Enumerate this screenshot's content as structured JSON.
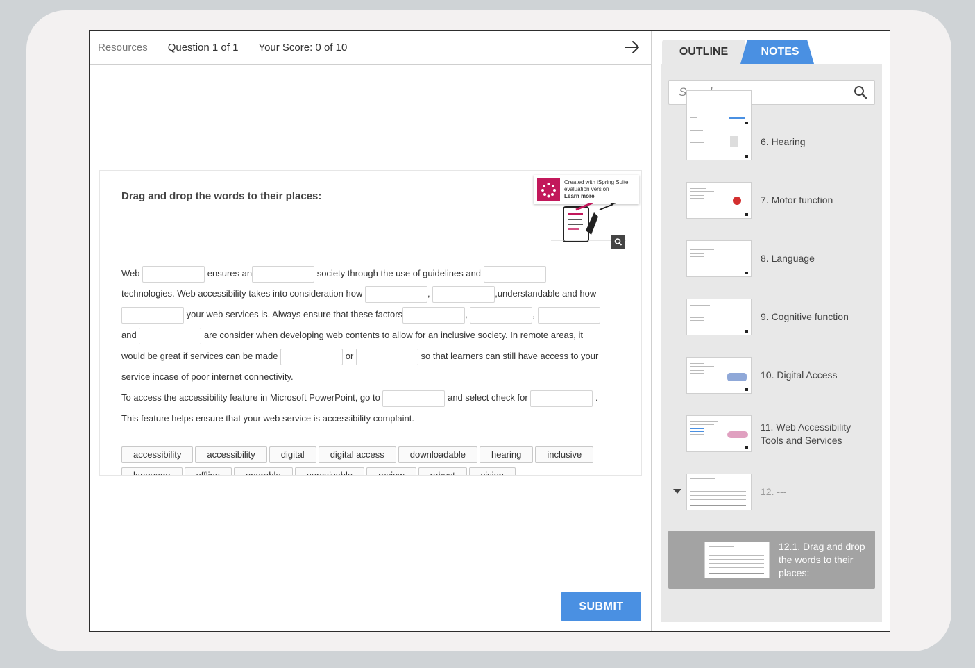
{
  "header": {
    "resources": "Resources",
    "question": "Question 1 of 1",
    "score": "Your Score: 0 of 10"
  },
  "slide": {
    "title": "Drag and drop the words to their places:",
    "watermark": {
      "line1": "Created with iSpring Suite",
      "line2": "evaluation version",
      "line3": "Learn more"
    },
    "passage": {
      "p1": "Web",
      "p2": "ensures an",
      "p3": "society through the use of guidelines and",
      "p4": "technologies. Web accessibility takes into consideration how",
      "p5": ",",
      "p6": ",understandable and how",
      "p7": "your web services is. Always ensure that these factors",
      "p8": ",",
      "p9": ",",
      "p10": "and",
      "p11": "are consider when developing web contents to allow for an inclusive society. In remote areas, it",
      "p12": "would be great if services can be made",
      "p13": "or",
      "p14": "so that learners can still have access to your",
      "p15": "service incase of poor internet connectivity.",
      "p16": "To access the accessibility feature in Microsoft PowerPoint, go to",
      "p17": "and select check for",
      "p18": ".",
      "p19": "This feature helps ensure that your web service is accessibility complaint."
    },
    "words": [
      "accessibility",
      "accessibility",
      "digital",
      "digital access",
      "downloadable",
      "hearing",
      "inclusive",
      "language",
      "offline",
      "operable",
      "perceivable",
      "review",
      "robust",
      "vision"
    ]
  },
  "footer": {
    "submit": "SUBMIT"
  },
  "sidebar": {
    "tabs": {
      "outline": "OUTLINE",
      "notes": "NOTES"
    },
    "search_placeholder": "Search",
    "items": [
      {
        "label": "6. Hearing"
      },
      {
        "label": "7. Motor function"
      },
      {
        "label": "8. Language"
      },
      {
        "label": "9. Cognitive function"
      },
      {
        "label": "10. Digital Access"
      },
      {
        "label": "11. Web Accessibility Tools and Services"
      },
      {
        "label": "12. ---"
      },
      {
        "label": "12.1.  Drag and drop the words to their places:"
      }
    ]
  },
  "colors": {
    "accent": "#4a90e2",
    "selected": "#a3a3a3",
    "ispring": "#c2185b"
  }
}
